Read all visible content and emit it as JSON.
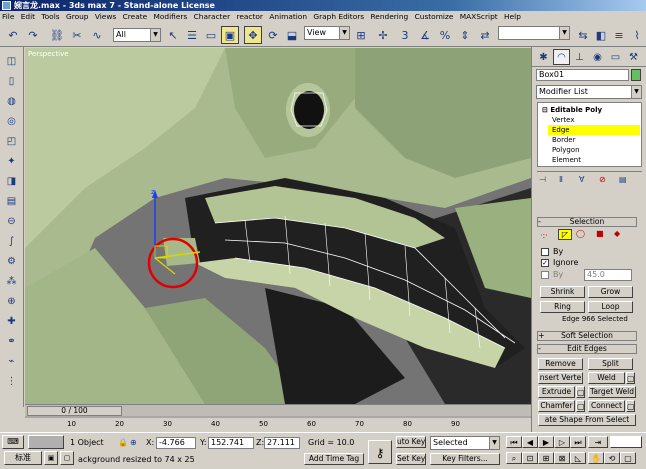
{
  "title": "婉言龙.max - 3ds max 7 - Stand-alone License",
  "menu": [
    "File",
    "Edit",
    "Tools",
    "Group",
    "Views",
    "Create",
    "Modifiers",
    "Character",
    "reactor",
    "Animation",
    "Graph Editors",
    "Rendering",
    "Customize",
    "MAXScript",
    "Help"
  ],
  "toolbar": {
    "selection_filter": "All",
    "ref_coord": "View",
    "named_selection": ""
  },
  "viewport": {
    "label": "Perspective"
  },
  "timeline": {
    "slider": "0 / 100",
    "ticks": [
      "10",
      "20",
      "30",
      "40",
      "50",
      "60",
      "70",
      "80",
      "90"
    ]
  },
  "command_panel": {
    "object_name": "Box01",
    "swatch_color": "#62c062",
    "modifier_list": "Modifier List",
    "stack": {
      "editable_poly": "Editable Poly",
      "items": [
        "Vertex",
        "Edge",
        "Border",
        "Polygon",
        "Element"
      ],
      "selected": "Edge"
    },
    "selection": {
      "header": "Selection",
      "by_label": "By",
      "ignore_label": "Ignore",
      "by2_label": "By",
      "angle": "45.0",
      "shrink": "Shrink",
      "grow": "Grow",
      "ring": "Ring",
      "loop": "Loop",
      "status": "Edge 966 Selected"
    },
    "soft_selection": "Soft Selection",
    "edit_edges": {
      "header": "Edit Edges",
      "remove": "Remove",
      "split": "Split",
      "insert_vertex": "nsert Verte",
      "weld": "Weld",
      "extrude": "Extrude",
      "target_weld": "Target Weld",
      "chamfer": "Chamfer",
      "connect": "Connect",
      "create_shape": "ate Shape From Select"
    }
  },
  "status": {
    "object_count": "1 Object",
    "x_label": "X:",
    "x": "-4.766",
    "y_label": "Y:",
    "y": "152.741",
    "z_label": "Z:",
    "z": "27.111",
    "grid": "Grid = 10.0",
    "prompt_button": "标准",
    "prompt": "ackground resized to 74 x 25",
    "add_time_tag": "Add Time Tag",
    "auto_key": "uto Key",
    "set_key": "Set Key",
    "key_mode": "Selected",
    "key_filters": "Key Filters..."
  }
}
